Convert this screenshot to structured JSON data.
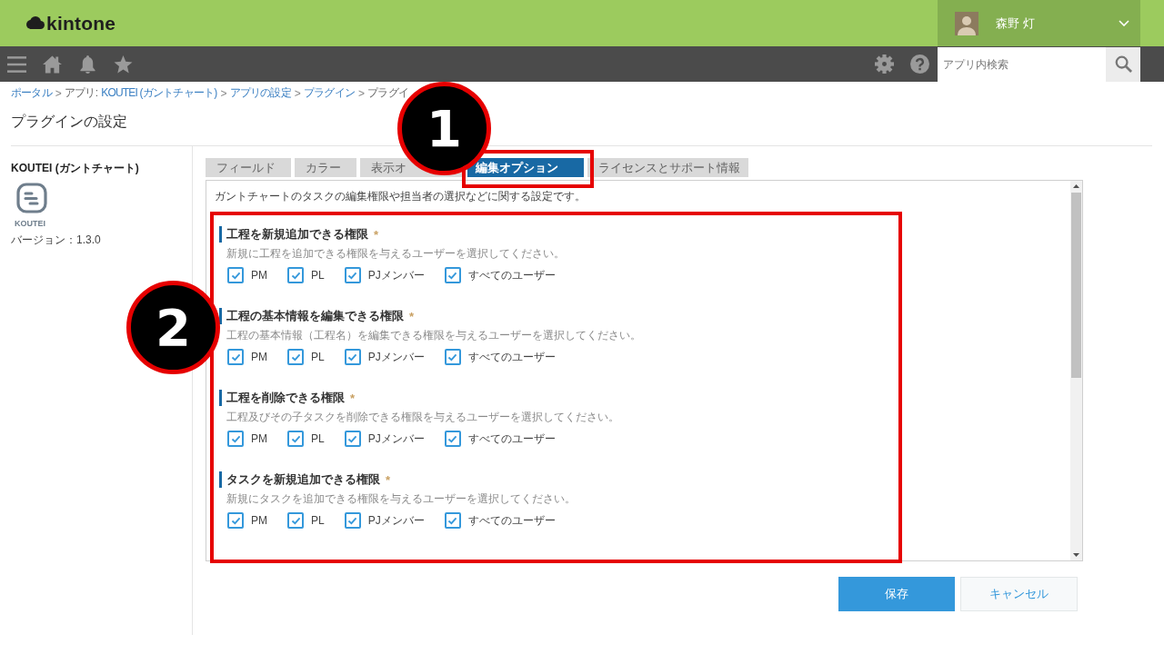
{
  "header": {
    "logo": "kintone",
    "user_name": "森野 灯"
  },
  "nav": {
    "search_placeholder": "アプリ内検索"
  },
  "breadcrumb": [
    {
      "label": "ポータル",
      "link": true
    },
    {
      "sep": ">",
      "prefix": "アプリ:",
      "label": "KOUTEI (ガントチャート)",
      "link": true
    },
    {
      "sep": ">",
      "label": "アプリの設定",
      "link": true
    },
    {
      "sep": ">",
      "label": "プラグイン",
      "link": true
    },
    {
      "sep": ">",
      "label": "プラグイ",
      "link": false
    }
  ],
  "page_title": "プラグインの設定",
  "plugin": {
    "name": "KOUTEI (ガントチャート)",
    "icon_label": "KOUTEI",
    "version": "バージョン：1.3.0"
  },
  "tabs": [
    {
      "label": "フィールド",
      "selected": false
    },
    {
      "label": "カラー",
      "selected": false
    },
    {
      "label": "表示オ",
      "selected": false
    },
    {
      "label": "編集オプション",
      "selected": true
    },
    {
      "label": "ライセンスとサポート情報",
      "selected": false
    }
  ],
  "panel": {
    "description": "ガントチャートのタスクの編集権限や担当者の選択などに関する設定です。",
    "sections": [
      {
        "title": "工程を新規追加できる権限",
        "required_mark": "*",
        "hint": "新規に工程を追加できる権限を与えるユーザーを選択してください。",
        "options": [
          {
            "label": "PM",
            "checked": true
          },
          {
            "label": "PL",
            "checked": true
          },
          {
            "label": "PJメンバー",
            "checked": true
          },
          {
            "label": "すべてのユーザー",
            "checked": true
          }
        ]
      },
      {
        "title": "工程の基本情報を編集できる権限",
        "required_mark": "*",
        "hint": "工程の基本情報（工程名）を編集できる権限を与えるユーザーを選択してください。",
        "options": [
          {
            "label": "PM",
            "checked": true
          },
          {
            "label": "PL",
            "checked": true
          },
          {
            "label": "PJメンバー",
            "checked": true
          },
          {
            "label": "すべてのユーザー",
            "checked": true
          }
        ]
      },
      {
        "title": "工程を削除できる権限",
        "required_mark": "*",
        "hint": "工程及びその子タスクを削除できる権限を与えるユーザーを選択してください。",
        "options": [
          {
            "label": "PM",
            "checked": true
          },
          {
            "label": "PL",
            "checked": true
          },
          {
            "label": "PJメンバー",
            "checked": true
          },
          {
            "label": "すべてのユーザー",
            "checked": true
          }
        ]
      },
      {
        "title": "タスクを新規追加できる権限",
        "required_mark": "*",
        "hint": "新規にタスクを追加できる権限を与えるユーザーを選択してください。",
        "options": [
          {
            "label": "PM",
            "checked": true
          },
          {
            "label": "PL",
            "checked": true
          },
          {
            "label": "PJメンバー",
            "checked": true
          },
          {
            "label": "すべてのユーザー",
            "checked": true
          }
        ]
      }
    ]
  },
  "buttons": [
    {
      "label": "保存",
      "kind": "primary"
    },
    {
      "label": "キャンセル",
      "kind": "secondary"
    }
  ],
  "annotations": [
    {
      "number": "1"
    },
    {
      "number": "2"
    }
  ]
}
